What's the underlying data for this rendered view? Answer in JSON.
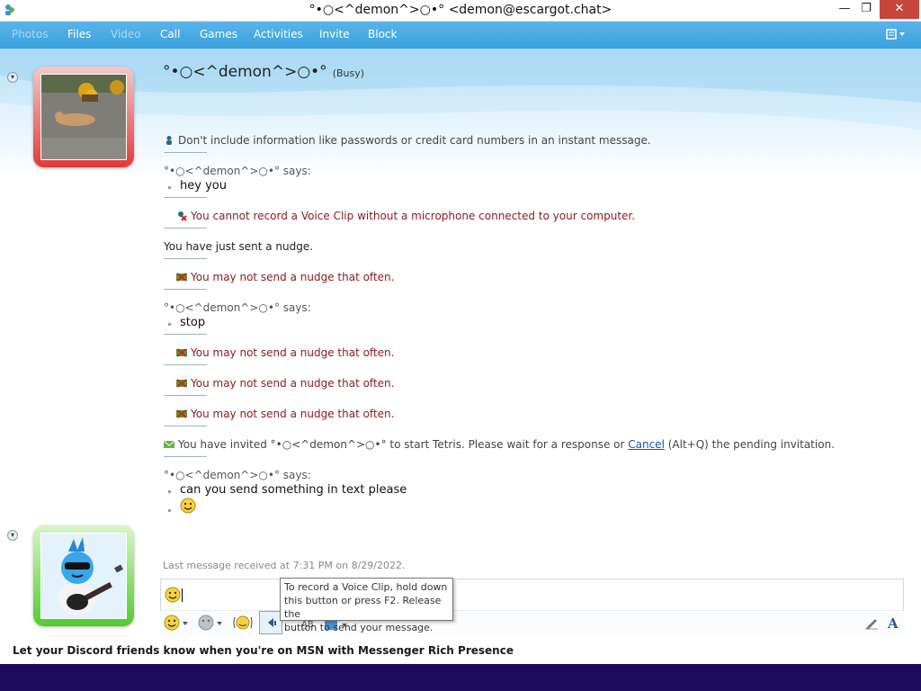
{
  "window": {
    "title": "°•○<^demon^>○•° <demon@escargot.chat>"
  },
  "toolbar": {
    "items": [
      "Photos",
      "Files",
      "Video",
      "Call",
      "Games",
      "Activities",
      "Invite",
      "Block"
    ]
  },
  "contact": {
    "name": "°•○<^demon^>○•°",
    "status": "(Busy)"
  },
  "conversation": {
    "warning": "Don't include information like passwords or credit card numbers in an instant message.",
    "says1": "°•○<^demon^>○•° says:",
    "msg1": "hey you",
    "voice_error": "You cannot record a Voice Clip without a microphone connected to your computer.",
    "nudge_sent": "You have just sent a nudge.",
    "nudge_err": "You may not send a nudge that often.",
    "says2": "°•○<^demon^>○•° says:",
    "msg2": "stop",
    "invite_prefix": "You have invited °•○<^demon^>○•° to start Tetris. Please wait for a response or ",
    "cancel_link": "Cancel",
    "invite_suffix": " (Alt+Q) the pending invitation.",
    "says3": "°•○<^demon^>○•° says:",
    "msg3": "can you send something in text please"
  },
  "last_message": "Last message received at 7:31 PM on 8/29/2022.",
  "tooltip": {
    "line1": "To record a Voice Clip, hold down",
    "line2": "this button or press F2. Release the",
    "line3": "button to send your message."
  },
  "promo": "Let your Discord friends know when you're on MSN with Messenger Rich Presence",
  "icons": {
    "app": "messenger-buddies-icon",
    "emoticon": "smiley-icon",
    "winks": "winks-icon",
    "nudge": "nudge-icon",
    "voice_clip": "voice-clip-icon",
    "font": "font-icon",
    "handwriting": "pen-icon"
  },
  "colors": {
    "toolbar": "#3aa0dd",
    "busy_frame": "#e03a3a",
    "online_frame": "#4fcc2c",
    "error_text": "#8b1a1a",
    "taskbar": "#1c0a5a"
  }
}
